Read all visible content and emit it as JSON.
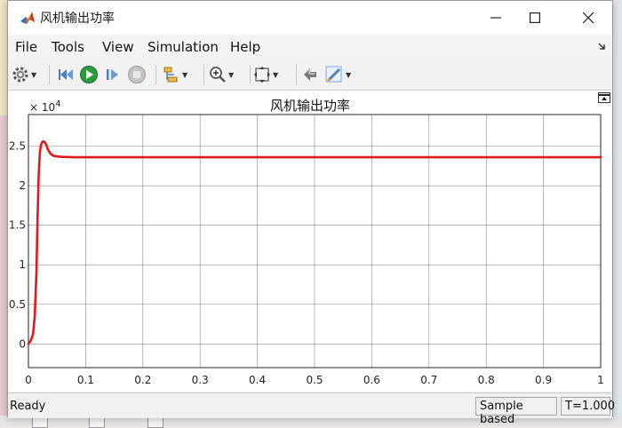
{
  "window": {
    "title": "风机输出功率"
  },
  "menu": {
    "file": "File",
    "tools": "Tools",
    "view": "View",
    "simulation": "Simulation",
    "help": "Help"
  },
  "plot": {
    "exponent_base": "× 10",
    "exponent_power": "4"
  },
  "chart_data": {
    "type": "line",
    "title": "风机输出功率",
    "xlabel": "",
    "ylabel": "",
    "xlim": [
      0,
      1
    ],
    "ylim": [
      -0.3,
      2.9
    ],
    "y_multiplier": 10000,
    "grid": true,
    "x_ticks": [
      0,
      0.1,
      0.2,
      0.3,
      0.4,
      0.5,
      0.6,
      0.7,
      0.8,
      0.9,
      1
    ],
    "x_tick_labels": [
      "0",
      "0.1",
      "0.2",
      "0.3",
      "0.4",
      "0.5",
      "0.6",
      "0.7",
      "0.8",
      "0.9",
      "1"
    ],
    "y_ticks": [
      0,
      0.5,
      1,
      1.5,
      2,
      2.5
    ],
    "y_tick_labels": [
      "0",
      "0.5",
      "1",
      "1.5",
      "2",
      "2.5"
    ],
    "series": [
      {
        "color": "#e0191a",
        "x": [
          0,
          0.004,
          0.008,
          0.011,
          0.014,
          0.016,
          0.018,
          0.02,
          0.022,
          0.025,
          0.028,
          0.031,
          0.034,
          0.038,
          0.043,
          0.05,
          0.06,
          0.08,
          0.1,
          0.2,
          0.4,
          0.6,
          0.8,
          1.0
        ],
        "y": [
          0,
          0.04,
          0.12,
          0.35,
          0.9,
          1.6,
          2.15,
          2.42,
          2.52,
          2.56,
          2.555,
          2.52,
          2.46,
          2.41,
          2.38,
          2.37,
          2.365,
          2.36,
          2.36,
          2.36,
          2.36,
          2.36,
          2.36,
          2.36
        ]
      }
    ]
  },
  "status": {
    "left": "Ready",
    "mode": "Sample based",
    "time": "T=1.000"
  }
}
